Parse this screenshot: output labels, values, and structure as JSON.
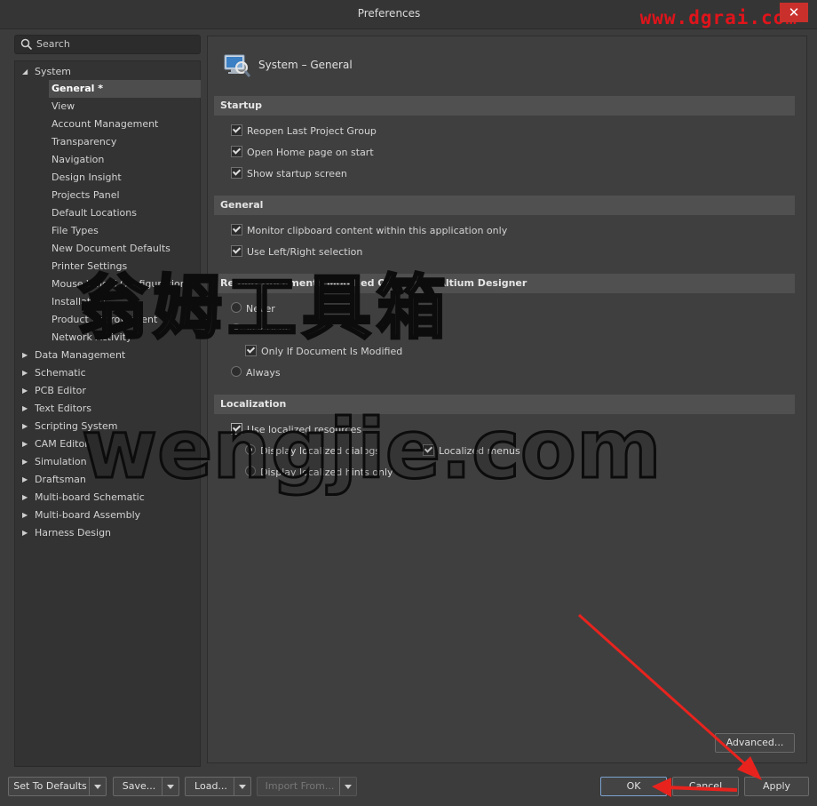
{
  "window": {
    "title": "Preferences",
    "close_glyph": "✕"
  },
  "watermark": {
    "url": "www.dgrai.com",
    "cn": "翁姆工具箱",
    "en": "wengjie.com"
  },
  "search": {
    "placeholder": "Search",
    "icon": "search-icon"
  },
  "tree": {
    "system": "System",
    "system_children": [
      "General *",
      "View",
      "Account Management",
      "Transparency",
      "Navigation",
      "Design Insight",
      "Projects Panel",
      "Default Locations",
      "File Types",
      "New Document Defaults",
      "Printer Settings",
      "Mouse Wheel Configuration",
      "Installation",
      "Product Improvement",
      "Network Activity"
    ],
    "roots": [
      "Data Management",
      "Schematic",
      "PCB Editor",
      "Text Editors",
      "Scripting System",
      "CAM Editor",
      "Simulation",
      "Draftsman",
      "Multi-board Schematic",
      "Multi-board Assembly",
      "Harness Design"
    ]
  },
  "content": {
    "header_title": "System – General",
    "startup": {
      "title": "Startup",
      "reopen": "Reopen Last Project Group",
      "home": "Open Home page on start",
      "splash": "Show startup screen"
    },
    "general": {
      "title": "General",
      "clipboard": "Monitor clipboard content within this application only",
      "leftright": "Use Left/Right selection"
    },
    "reload": {
      "title": "Reload Documents Modified Outside of Altium Designer",
      "never": "Never",
      "ask": "Ask User",
      "only_if": "Only If Document Is Modified",
      "always": "Always"
    },
    "localization": {
      "title": "Localization",
      "use": "Use localized resources",
      "dialogs": "Display localized dialogs",
      "menus": "Localized menus",
      "hints": "Display localized hints only"
    },
    "advanced": "Advanced..."
  },
  "footer": {
    "defaults": "Set To Defaults",
    "save": "Save...",
    "load": "Load...",
    "import": "Import From...",
    "ok": "OK",
    "cancel": "Cancel",
    "apply": "Apply"
  },
  "colors": {
    "annotation_red": "#e8231e",
    "accent_focus": "#7ca2cf"
  }
}
